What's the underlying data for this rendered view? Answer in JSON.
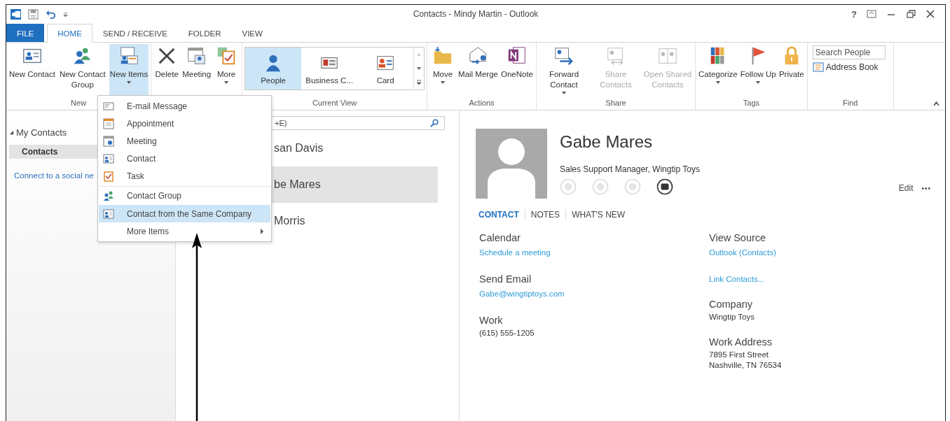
{
  "window": {
    "title": "Contacts - Mindy Martin - Outlook",
    "help": "?"
  },
  "tabs": [
    {
      "label": "FILE",
      "kind": "file",
      "selected": false
    },
    {
      "label": "HOME",
      "kind": "tab",
      "selected": true
    },
    {
      "label": "SEND / RECEIVE",
      "kind": "tab",
      "selected": false
    },
    {
      "label": "FOLDER",
      "kind": "tab",
      "selected": false
    },
    {
      "label": "VIEW",
      "kind": "tab",
      "selected": false
    }
  ],
  "ribbon": {
    "groups": [
      {
        "label": "New",
        "kind": "buttons",
        "buttons": [
          {
            "label": "New Contact",
            "caret": false,
            "selected": false,
            "disabled": false
          },
          {
            "label": "New Contact Group",
            "caret": false,
            "selected": false,
            "disabled": false
          },
          {
            "label": "New Items",
            "caret": true,
            "selected": true,
            "disabled": false
          }
        ]
      },
      {
        "kind": "buttons",
        "buttons": [
          {
            "label": "Delete",
            "caret": false,
            "selected": false,
            "disabled": false
          },
          {
            "label": "Meeting",
            "caret": false,
            "selected": false,
            "disabled": false
          },
          {
            "label": "More",
            "caret": true,
            "selected": false,
            "disabled": false
          }
        ]
      },
      {
        "label": "Current View",
        "kind": "gallery",
        "buttons": [
          {
            "label": "People",
            "selected": true
          },
          {
            "label": "Business C...",
            "selected": false
          },
          {
            "label": "Card",
            "selected": false
          }
        ]
      },
      {
        "label": "Actions",
        "kind": "buttons",
        "buttons": [
          {
            "label": "Move",
            "caret": true,
            "selected": false,
            "disabled": false
          },
          {
            "label": "Mail Merge",
            "caret": false,
            "selected": false,
            "disabled": false
          },
          {
            "label": "OneNote",
            "caret": false,
            "selected": false,
            "disabled": false
          }
        ]
      },
      {
        "label": "Share",
        "kind": "buttons",
        "buttons": [
          {
            "label": "Forward Contact",
            "caret": true,
            "selected": false,
            "disabled": false
          },
          {
            "label": "Share Contacts",
            "caret": false,
            "selected": false,
            "disabled": true
          },
          {
            "label": "Open Shared Contacts",
            "caret": false,
            "selected": false,
            "disabled": true
          }
        ]
      },
      {
        "label": "Tags",
        "kind": "buttons",
        "buttons": [
          {
            "label": "Categorize",
            "caret": true,
            "selected": false,
            "disabled": false
          },
          {
            "label": "Follow Up",
            "caret": true,
            "selected": false,
            "disabled": false
          },
          {
            "label": "Private",
            "caret": false,
            "selected": false,
            "disabled": false
          }
        ]
      },
      {
        "label": "Find",
        "kind": "find",
        "search": {
          "placeholder": "Search People"
        },
        "link": "Address Book"
      }
    ]
  },
  "folders": {
    "header": {
      "label": "My Contacts",
      "expanded": true
    },
    "items": [
      {
        "label": "Contacts",
        "selected": true
      }
    ],
    "link": "Connect to a social ne"
  },
  "contact_list": {
    "search": {
      "placeholder": "+E)"
    },
    "items": [
      {
        "name": "san Davis",
        "selected": false
      },
      {
        "name": "be Mares",
        "selected": true
      },
      {
        "name": "Morris",
        "selected": false
      }
    ]
  },
  "menu": {
    "items": [
      {
        "label": "E-mail Message",
        "selected": false,
        "divider_before": false,
        "submenu": false
      },
      {
        "label": "Appointment",
        "selected": false,
        "divider_before": false,
        "submenu": false
      },
      {
        "label": "Meeting",
        "selected": false,
        "divider_before": false,
        "submenu": false
      },
      {
        "label": "Contact",
        "selected": false,
        "divider_before": false,
        "submenu": false
      },
      {
        "label": "Task",
        "selected": false,
        "divider_before": false,
        "submenu": false
      },
      {
        "label": "Contact Group",
        "selected": false,
        "divider_before": true,
        "submenu": false
      },
      {
        "label": "Contact from the Same Company",
        "selected": true,
        "divider_before": false,
        "submenu": false
      },
      {
        "label": "More Items",
        "selected": false,
        "divider_before": false,
        "submenu": true
      }
    ]
  },
  "card": {
    "name": "Gabe Mares",
    "subtitle": "Sales Support Manager, Wingtip Toys",
    "actions": [
      {
        "enabled": false
      },
      {
        "enabled": false
      },
      {
        "enabled": false
      },
      {
        "enabled": true
      }
    ],
    "edit": "Edit",
    "more": "•••",
    "tabs": [
      {
        "label": "CONTACT",
        "selected": true
      },
      {
        "label": "NOTES",
        "selected": false
      },
      {
        "label": "WHAT'S NEW",
        "selected": false
      }
    ],
    "left": [
      {
        "label": "Calendar",
        "kind": "link",
        "lines": [
          "Schedule a meeting"
        ]
      },
      {
        "label": "Send Email",
        "kind": "link",
        "lines": [
          "Gabe@wingtiptoys.com"
        ]
      },
      {
        "label": "Work",
        "kind": "text",
        "lines": [
          "(615) 555-1205"
        ]
      }
    ],
    "right": [
      {
        "label": "View Source",
        "kind": "link",
        "lines": [
          "Outlook (Contacts)"
        ]
      },
      {
        "kind": "link",
        "lines": [
          "Link Contacts..."
        ]
      },
      {
        "label": "Company",
        "kind": "text",
        "lines": [
          "Wingtip Toys"
        ]
      },
      {
        "label": "Work Address",
        "kind": "text",
        "lines": [
          "7895 First Street",
          "Nashville, TN 76534"
        ]
      }
    ]
  }
}
